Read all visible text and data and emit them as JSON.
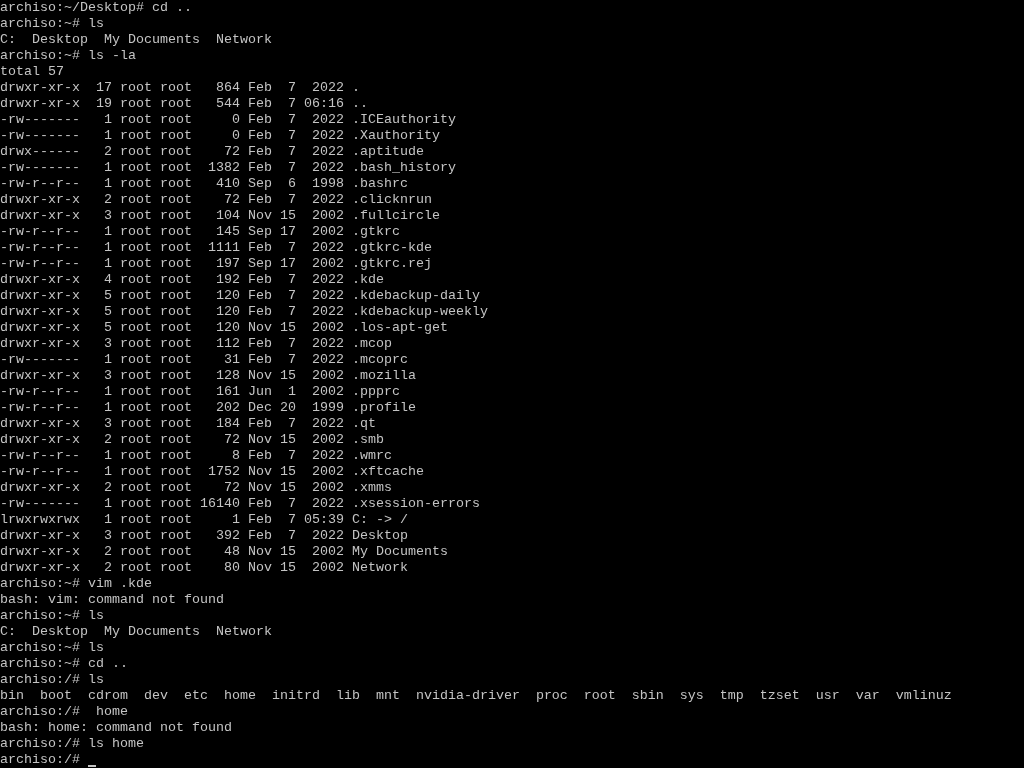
{
  "console": {
    "lines": [
      "archiso:~/Desktop# cd ..",
      "archiso:~# ls",
      "C:  Desktop  My Documents  Network",
      "archiso:~# ls -la",
      "total 57",
      "drwxr-xr-x  17 root root   864 Feb  7  2022 .",
      "drwxr-xr-x  19 root root   544 Feb  7 06:16 ..",
      "-rw-------   1 root root     0 Feb  7  2022 .ICEauthority",
      "-rw-------   1 root root     0 Feb  7  2022 .Xauthority",
      "drwx------   2 root root    72 Feb  7  2022 .aptitude",
      "-rw-------   1 root root  1382 Feb  7  2022 .bash_history",
      "-rw-r--r--   1 root root   410 Sep  6  1998 .bashrc",
      "drwxr-xr-x   2 root root    72 Feb  7  2022 .clicknrun",
      "drwxr-xr-x   3 root root   104 Nov 15  2002 .fullcircle",
      "-rw-r--r--   1 root root   145 Sep 17  2002 .gtkrc",
      "-rw-r--r--   1 root root  1111 Feb  7  2022 .gtkrc-kde",
      "-rw-r--r--   1 root root   197 Sep 17  2002 .gtkrc.rej",
      "drwxr-xr-x   4 root root   192 Feb  7  2022 .kde",
      "drwxr-xr-x   5 root root   120 Feb  7  2022 .kdebackup-daily",
      "drwxr-xr-x   5 root root   120 Feb  7  2022 .kdebackup-weekly",
      "drwxr-xr-x   5 root root   120 Nov 15  2002 .los-apt-get",
      "drwxr-xr-x   3 root root   112 Feb  7  2022 .mcop",
      "-rw-------   1 root root    31 Feb  7  2022 .mcoprc",
      "drwxr-xr-x   3 root root   128 Nov 15  2002 .mozilla",
      "-rw-r--r--   1 root root   161 Jun  1  2002 .ppprc",
      "-rw-r--r--   1 root root   202 Dec 20  1999 .profile",
      "drwxr-xr-x   3 root root   184 Feb  7  2022 .qt",
      "drwxr-xr-x   2 root root    72 Nov 15  2002 .smb",
      "-rw-r--r--   1 root root     8 Feb  7  2022 .wmrc",
      "-rw-r--r--   1 root root  1752 Nov 15  2002 .xftcache",
      "drwxr-xr-x   2 root root    72 Nov 15  2002 .xmms",
      "-rw-------   1 root root 16140 Feb  7  2022 .xsession-errors",
      "lrwxrwxrwx   1 root root     1 Feb  7 05:39 C: -> /",
      "drwxr-xr-x   3 root root   392 Feb  7  2022 Desktop",
      "drwxr-xr-x   2 root root    48 Nov 15  2002 My Documents",
      "drwxr-xr-x   2 root root    80 Nov 15  2002 Network",
      "archiso:~# vim .kde",
      "bash: vim: command not found",
      "archiso:~# ls",
      "C:  Desktop  My Documents  Network",
      "archiso:~# ls",
      "archiso:~# cd ..",
      "archiso:/# ls",
      "bin  boot  cdrom  dev  etc  home  initrd  lib  mnt  nvidia-driver  proc  root  sbin  sys  tmp  tzset  usr  var  vmlinuz",
      "archiso:/#  home",
      "bash: home: command not found",
      "archiso:/# ls home"
    ],
    "prompt": "archiso:/#",
    "cursor_visible": true
  }
}
